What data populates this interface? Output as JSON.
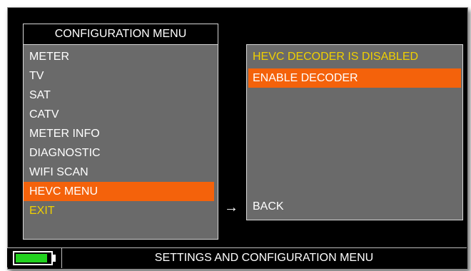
{
  "menu": {
    "title": "CONFIGURATION MENU",
    "items": [
      {
        "label": "METER"
      },
      {
        "label": "TV"
      },
      {
        "label": "SAT"
      },
      {
        "label": "CATV"
      },
      {
        "label": "METER INFO"
      },
      {
        "label": "DIAGNOSTIC"
      },
      {
        "label": "WIFI SCAN"
      },
      {
        "label": "HEVC MENU",
        "selected": true
      },
      {
        "label": "EXIT"
      }
    ]
  },
  "arrow": "→",
  "hevc": {
    "status": "HEVC DECODER IS DISABLED",
    "enable_label": "ENABLE DECODER",
    "back_label": "BACK"
  },
  "status_bar": {
    "battery_level": 0.92,
    "text": "SETTINGS AND CONFIGURATION MENU"
  },
  "colors": {
    "highlight": "#f4620b",
    "status_yellow": "#f0d000",
    "panel_gray": "#6a6a6a",
    "battery_green": "#22d21f"
  }
}
